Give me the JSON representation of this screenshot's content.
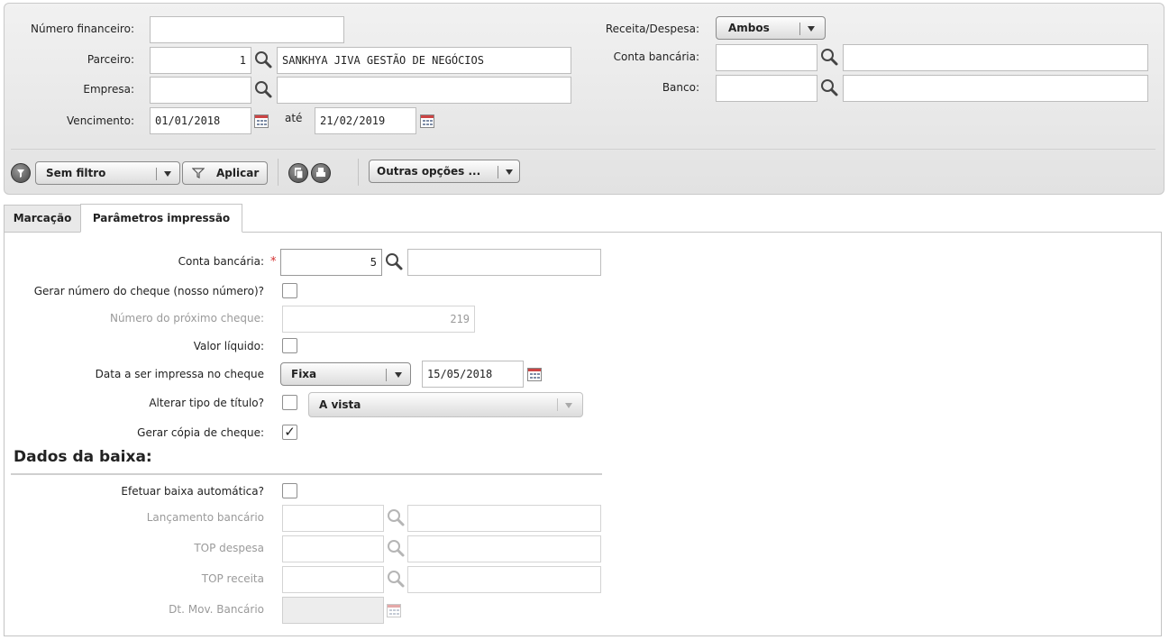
{
  "filter": {
    "numero_financeiro_label": "Número financeiro:",
    "numero_financeiro_value": "",
    "parceiro_label": "Parceiro:",
    "parceiro_code": "1",
    "parceiro_name": "SANKHYA JIVA GESTÃO DE NEGÓCIOS",
    "empresa_label": "Empresa:",
    "empresa_code": "",
    "empresa_name": "",
    "vencimento_label": "Vencimento:",
    "vencimento_from": "01/01/2018",
    "ate_label": "até",
    "vencimento_to": "21/02/2019",
    "receita_despesa_label": "Receita/Despesa:",
    "receita_despesa_value": "Ambos",
    "conta_bancaria_label": "Conta bancária:",
    "conta_bancaria_code": "",
    "conta_bancaria_name": "",
    "banco_label": "Banco:",
    "banco_code": "",
    "banco_name": ""
  },
  "toolbar": {
    "sem_filtro_label": "Sem filtro",
    "aplicar_label": "Aplicar",
    "outras_opcoes_label": "Outras opções ..."
  },
  "tabs": [
    {
      "label": "Marcação",
      "active": false
    },
    {
      "label": "Parâmetros impressão",
      "active": true
    }
  ],
  "params": {
    "conta_bancaria_label": "Conta bancária:",
    "required_mark": "*",
    "conta_bancaria_code": "5",
    "conta_bancaria_name": "",
    "gerar_numero_label": "Gerar número do cheque (nosso número)?",
    "gerar_numero_checked": false,
    "numero_proximo_label": "Número do próximo cheque:",
    "numero_proximo_value": "219",
    "valor_liquido_label": "Valor líquido:",
    "valor_liquido_checked": false,
    "data_impressa_label": "Data a ser impressa no cheque",
    "data_tipo_value": "Fixa",
    "data_value": "15/05/2018",
    "alterar_tipo_label": "Alterar tipo de título?",
    "alterar_tipo_checked": false,
    "tipo_titulo_value": "A vista",
    "gerar_copia_label": "Gerar cópia de cheque:",
    "gerar_copia_checked": true,
    "check_glyph": "✓"
  },
  "baixa": {
    "section_title": "Dados da baixa:",
    "efetuar_label": "Efetuar baixa automática?",
    "efetuar_checked": false,
    "lancamento_label": "Lançamento bancário",
    "top_despesa_label": "TOP despesa",
    "top_receita_label": "TOP receita",
    "dt_mov_label": "Dt. Mov. Bancário"
  }
}
